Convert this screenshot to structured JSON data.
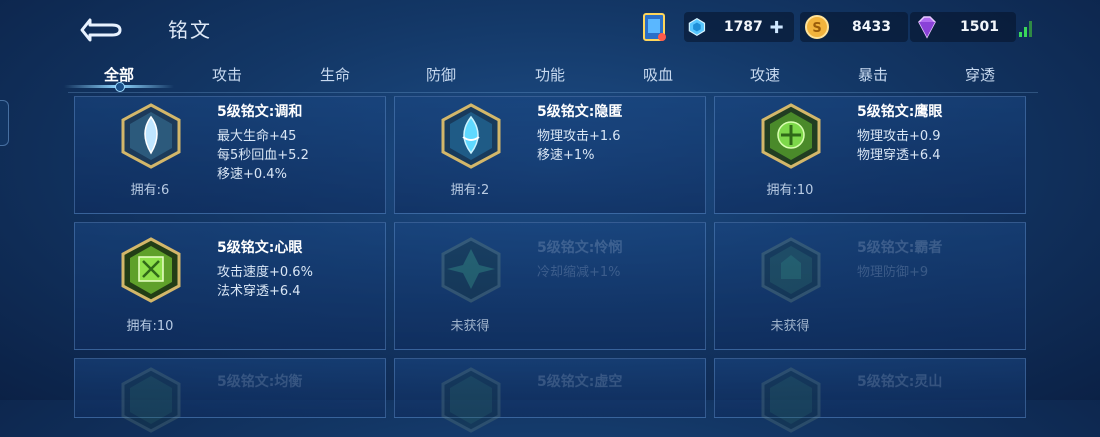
{
  "header": {
    "title": "铭文",
    "resources": [
      {
        "icon": "inscription-box-icon",
        "value": ""
      },
      {
        "icon": "crystal-icon",
        "value": "1787"
      },
      {
        "icon": "gold-coin-icon",
        "value": "8433"
      },
      {
        "icon": "diamond-icon",
        "value": "1501"
      }
    ]
  },
  "tabs": [
    "全部",
    "攻击",
    "生命",
    "防御",
    "功能",
    "吸血",
    "攻速",
    "暴击",
    "穿透"
  ],
  "cards": [
    {
      "name": "5级铭文:调和",
      "stats": [
        "最大生命+45",
        "每5秒回血+5.2",
        "移速+0.4%"
      ],
      "owned": "拥有:6",
      "color": "#bfe6ff"
    },
    {
      "name": "5级铭文:隐匿",
      "stats": [
        "物理攻击+1.6",
        "移速+1%"
      ],
      "owned": "拥有:2",
      "color": "#5fd9ff"
    },
    {
      "name": "5级铭文:鹰眼",
      "stats": [
        "物理攻击+0.9",
        "物理穿透+6.4"
      ],
      "owned": "拥有:10",
      "color": "#7dd84a"
    },
    {
      "name": "5级铭文:心眼",
      "stats": [
        "攻击速度+0.6%",
        "法术穿透+6.4"
      ],
      "owned": "拥有:10",
      "color": "#8ee04a"
    },
    {
      "name": "5级铭文:怜悯",
      "stats": [
        "冷却缩减+1%"
      ],
      "owned": "未获得",
      "color": "#3fa070"
    },
    {
      "name": "5级铭文:霸者",
      "stats": [
        "物理防御+9"
      ],
      "owned": "未获得",
      "color": "#3fa070"
    },
    {
      "name": "5级铭文:均衡",
      "stats": [],
      "owned": "",
      "color": "#3fa070"
    },
    {
      "name": "5级铭文:虚空",
      "stats": [],
      "owned": "",
      "color": "#3fa070"
    },
    {
      "name": "5级铭文:灵山",
      "stats": [],
      "owned": "",
      "color": "#3fa070"
    }
  ]
}
